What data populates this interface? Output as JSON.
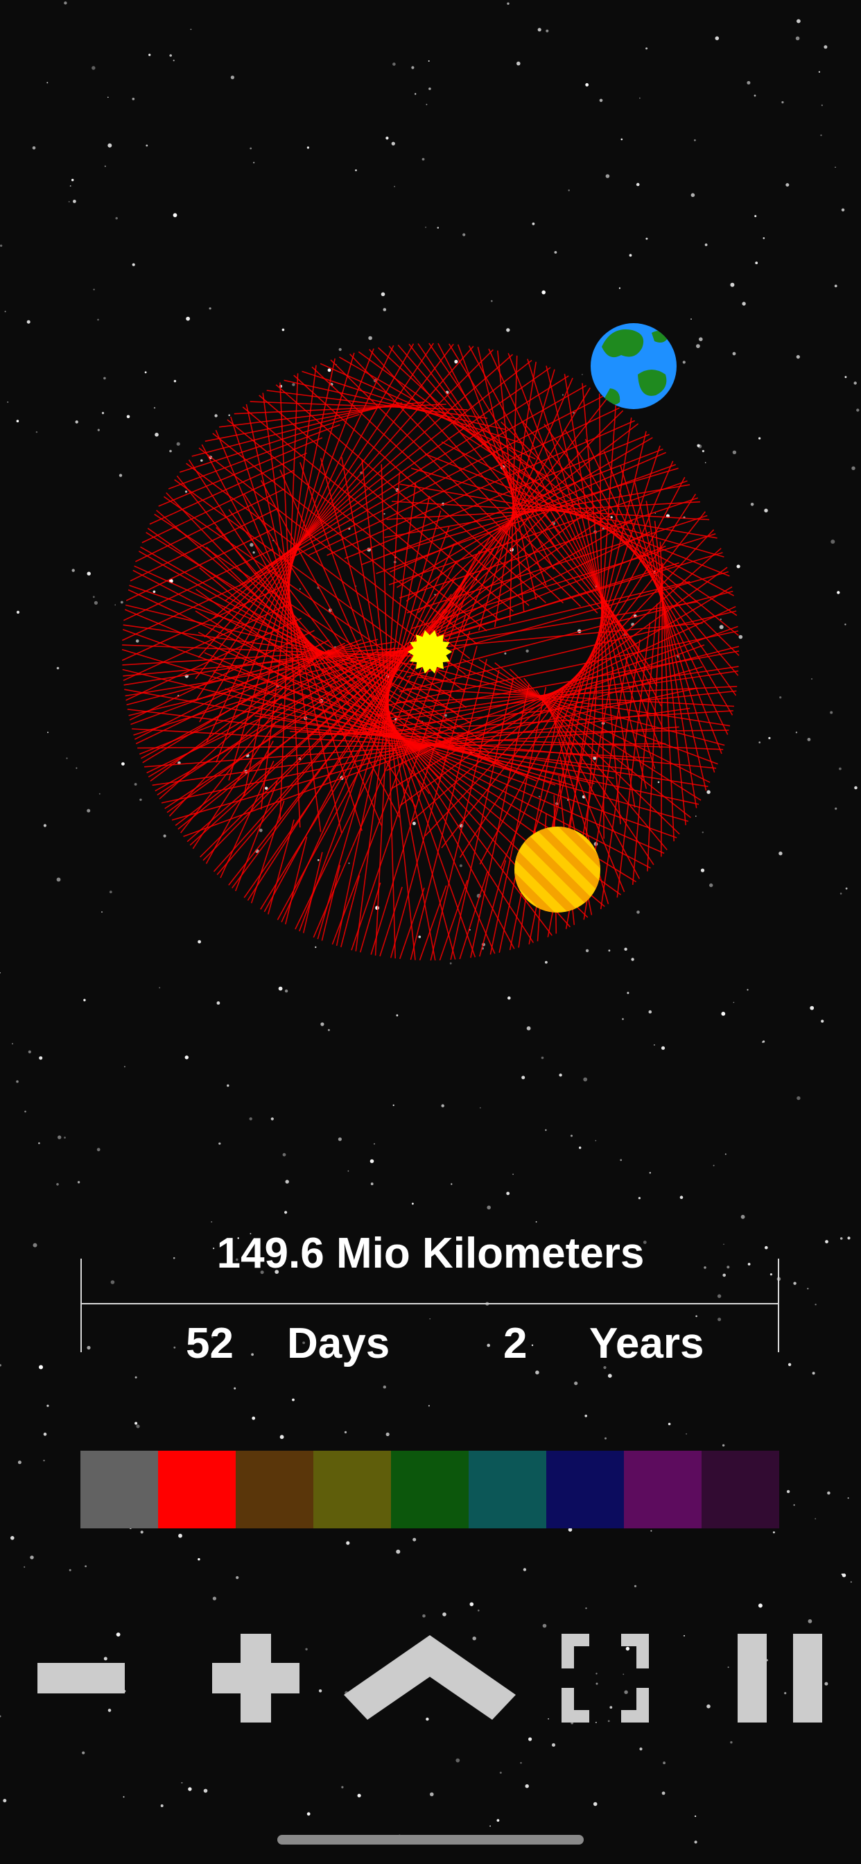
{
  "measurement": {
    "distance": "149.6 Mio Kilometers",
    "days_value": "52",
    "days_label": "Days",
    "years_value": "2",
    "years_label": "Years"
  },
  "palette": {
    "colors": [
      "#626262",
      "#ff0000",
      "#5a360a",
      "#5f5e0b",
      "#0c570c",
      "#0c5757",
      "#0c0c5e",
      "#5d0c5e",
      "#320b32"
    ]
  },
  "orbit": {
    "line_color": "#ff0000",
    "sun_color": "#ffff00",
    "planet_inner_color": "#ffcc00",
    "planet_outer_colors": [
      "#1e90ff",
      "#1f8a1f"
    ]
  },
  "controls": {
    "zoom_out": "minus-icon",
    "zoom_in": "plus-icon",
    "collapse": "chevron-up-icon",
    "fullscreen": "fullscreen-icon",
    "pause": "pause-icon",
    "icon_color": "#cccccc"
  }
}
